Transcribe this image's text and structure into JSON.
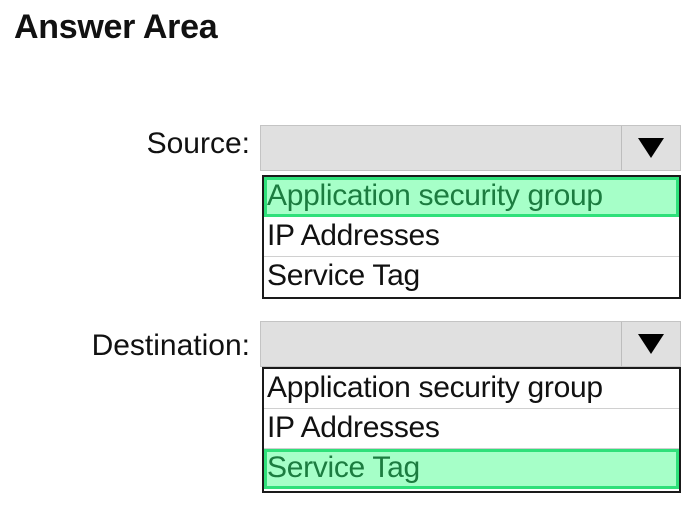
{
  "title": "Answer Area",
  "source": {
    "label": "Source:",
    "selected_index": 0,
    "options": [
      {
        "label": "Application security group"
      },
      {
        "label": "IP Addresses"
      },
      {
        "label": "Service Tag"
      }
    ]
  },
  "destination": {
    "label": "Destination:",
    "selected_index": 2,
    "options": [
      {
        "label": "Application security group"
      },
      {
        "label": "IP Addresses"
      },
      {
        "label": "Service Tag"
      }
    ]
  },
  "icons": {
    "dropdown_arrow": "triangle-down-icon"
  },
  "colors": {
    "selected_bg": "#a6ffc8",
    "selected_border": "#2fe07a",
    "selected_text": "#1c7c40",
    "dropdown_bg": "#e0e0e0"
  }
}
